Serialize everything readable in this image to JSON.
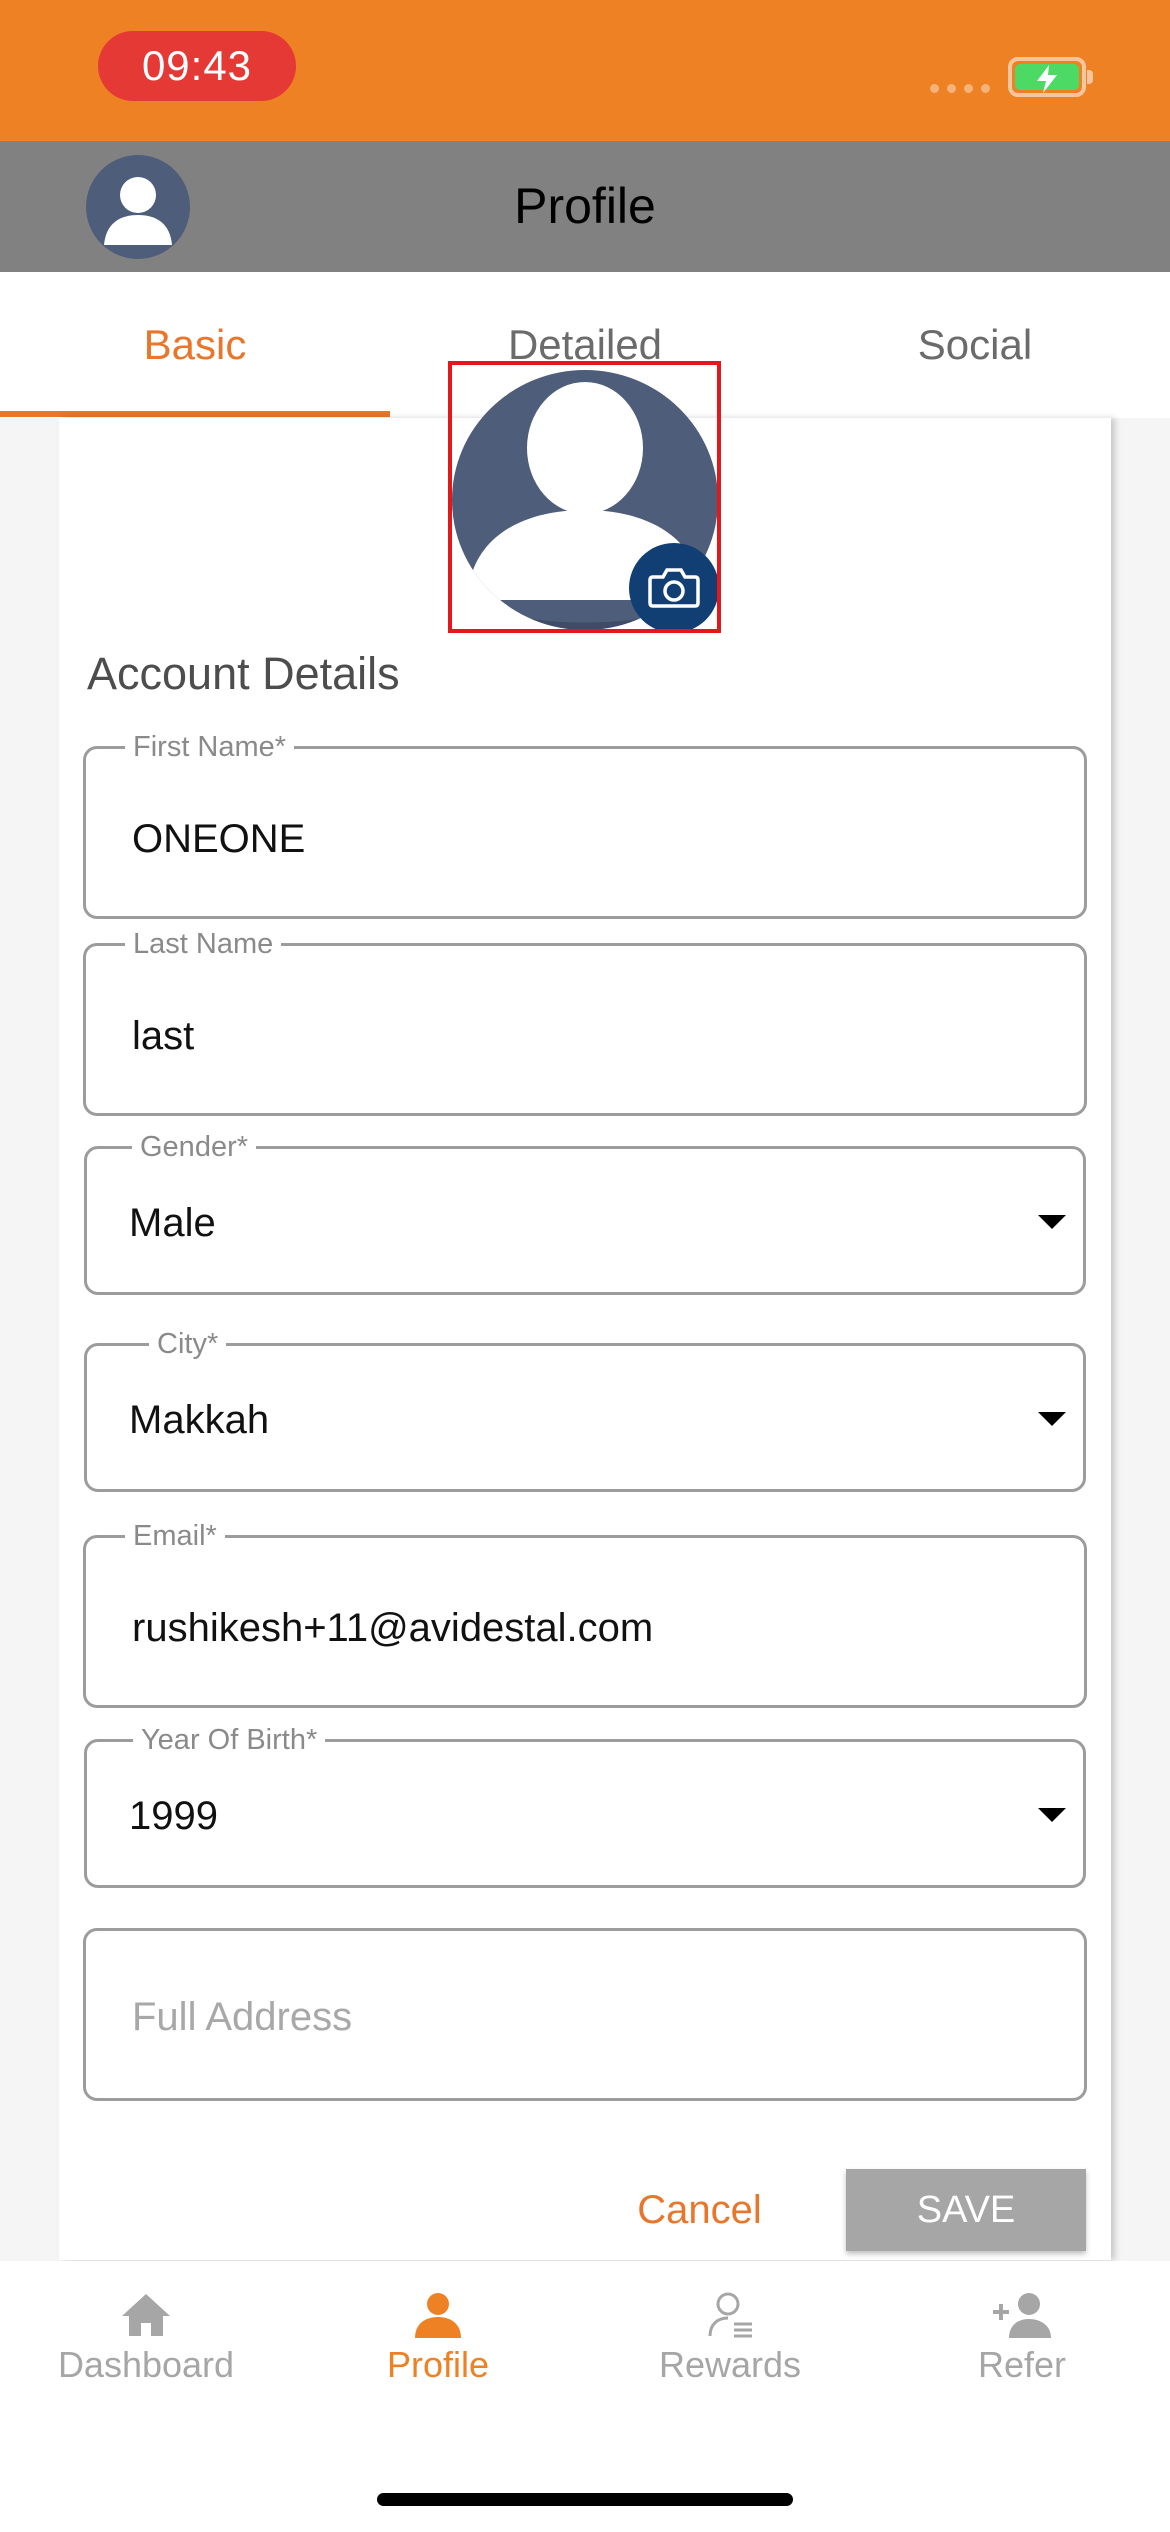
{
  "status_bar": {
    "time": "09:43"
  },
  "header": {
    "title": "Profile"
  },
  "tabs": [
    {
      "label": "Basic",
      "active": true
    },
    {
      "label": "Detailed",
      "active": false
    },
    {
      "label": "Social",
      "active": false
    }
  ],
  "section": {
    "title": "Account Details"
  },
  "fields": {
    "first_name": {
      "label": "First Name*",
      "value": "ONEONE"
    },
    "last_name": {
      "label": "Last Name",
      "value": "last"
    },
    "gender": {
      "label": "Gender*",
      "value": "Male"
    },
    "city": {
      "label": "City*",
      "value": "Makkah"
    },
    "email": {
      "label": "Email*",
      "value": "rushikesh+11@avidestal.com"
    },
    "year_of_birth": {
      "label": "Year Of Birth*",
      "value": "1999"
    },
    "full_address": {
      "placeholder": "Full Address",
      "value": ""
    }
  },
  "actions": {
    "cancel_label": "Cancel",
    "save_label": "SAVE"
  },
  "bottom_nav": [
    {
      "label": "Dashboard",
      "icon": "home-icon",
      "active": false
    },
    {
      "label": "Profile",
      "icon": "person-icon",
      "active": true
    },
    {
      "label": "Rewards",
      "icon": "rewards-icon",
      "active": false
    },
    {
      "label": "Refer",
      "icon": "add-person-icon",
      "active": false
    }
  ],
  "colors": {
    "accent": "#ef8125",
    "app_bar": "#818181",
    "avatar": "#4e5d79",
    "camera_button": "#123f73",
    "save_disabled": "#a6a6a6"
  }
}
